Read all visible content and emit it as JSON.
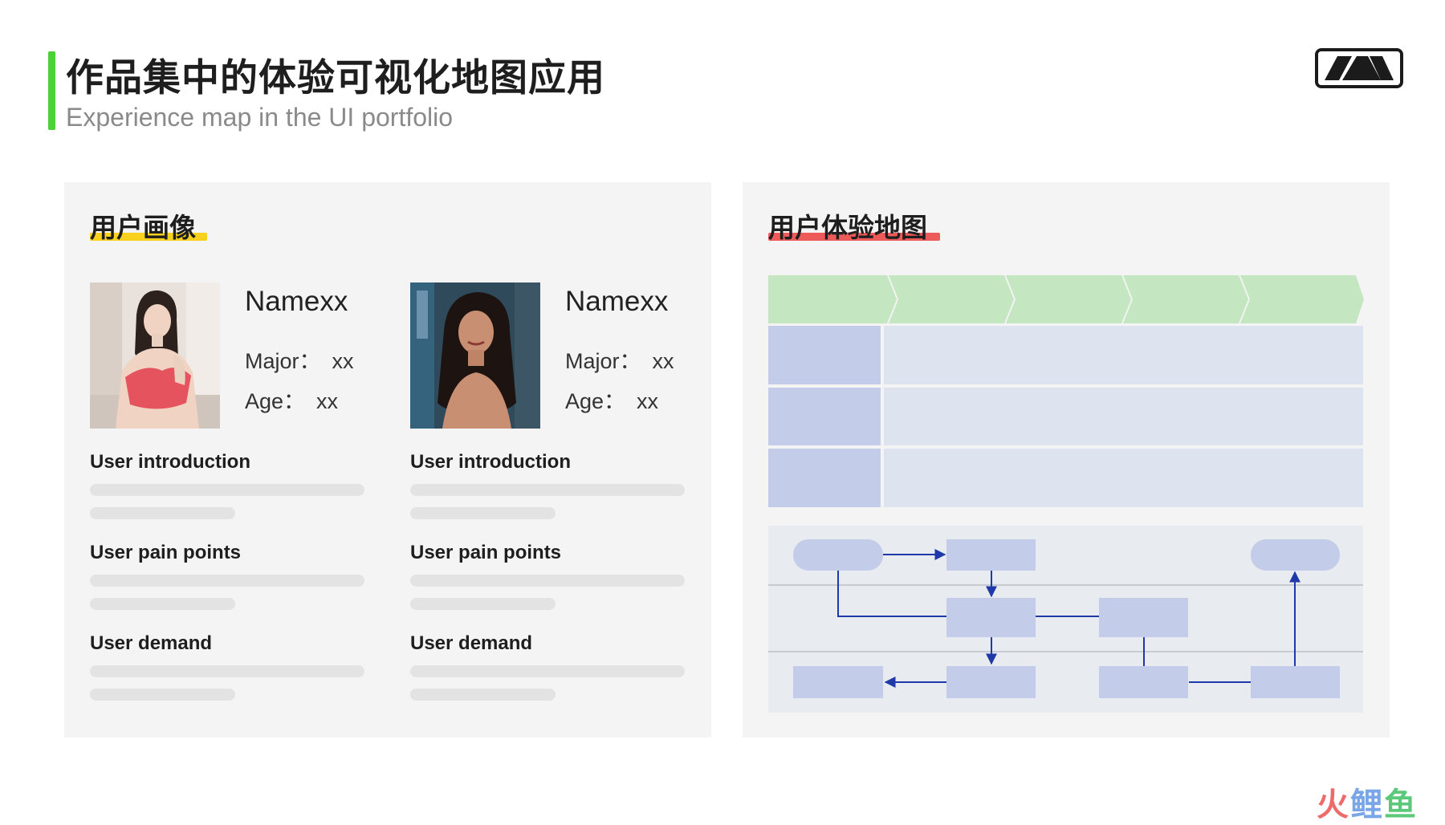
{
  "header": {
    "title": "作品集中的体验可视化地图应用",
    "subtitle": "Experience map in the UI portfolio",
    "accent_color": "#4cd137",
    "logo_icon": "brand-mountain-logo-icon"
  },
  "persona_panel": {
    "title": "用户画像",
    "highlight_color": "#f7d11e",
    "personas": [
      {
        "name": "Namexx",
        "major_label": "Major：",
        "major_value": "xx",
        "age_label": "Age：",
        "age_value": "xx",
        "fields": [
          "User introduction",
          "User pain points",
          "User demand"
        ]
      },
      {
        "name": "Namexx",
        "major_label": "Major：",
        "major_value": "xx",
        "age_label": "Age：",
        "age_value": "xx",
        "fields": [
          "User introduction",
          "User pain points",
          "User demand"
        ]
      }
    ]
  },
  "journey_panel": {
    "title": "用户体验地图",
    "highlight_color": "#ec5a5a",
    "stage_color": "#c4e6c0",
    "row_header_color": "#c3cde9",
    "row_body_color": "#dde3ef",
    "node_color": "#c3cde9",
    "line_color": "#1f3aa8",
    "stage_count": 5,
    "row_count": 3
  },
  "watermark": {
    "chars": [
      "火",
      "鲤",
      "鱼"
    ],
    "colors": [
      "#ee6b6b",
      "#7aa6e8",
      "#5cc97a"
    ]
  }
}
